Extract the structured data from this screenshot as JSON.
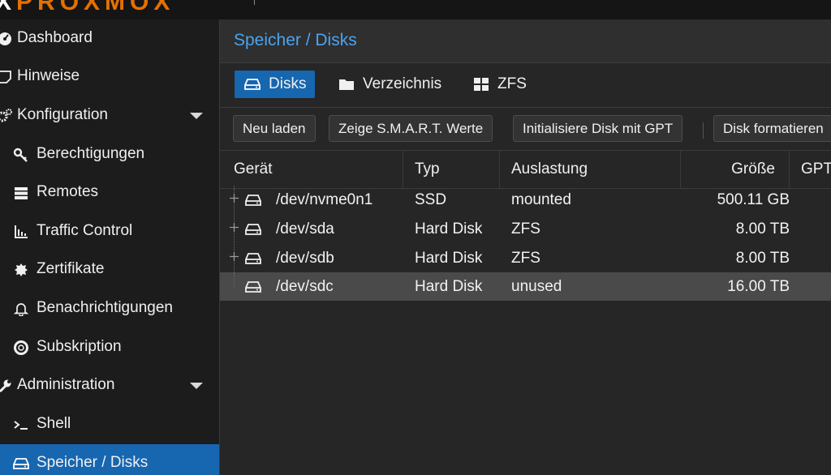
{
  "topbar": {
    "logo": "PROXMOX",
    "logo_x": "X"
  },
  "sidebar": {
    "items": [
      {
        "label": "Dashboard",
        "icon": "dashboard-icon"
      },
      {
        "label": "Hinweise",
        "icon": "note-icon"
      },
      {
        "label": "Konfiguration",
        "icon": "cogs-icon",
        "expanded": true
      },
      {
        "label": "Berechtigungen",
        "icon": "key-icon"
      },
      {
        "label": "Remotes",
        "icon": "server-icon"
      },
      {
        "label": "Traffic Control",
        "icon": "bar-chart-icon"
      },
      {
        "label": "Zertifikate",
        "icon": "certificate-icon"
      },
      {
        "label": "Benachrichtigungen",
        "icon": "bell-icon"
      },
      {
        "label": "Subskription",
        "icon": "support-icon"
      },
      {
        "label": "Administration",
        "icon": "wrench-icon",
        "expanded": true
      },
      {
        "label": "Shell",
        "icon": "terminal-icon"
      },
      {
        "label": "Speicher / Disks",
        "icon": "hdd-icon",
        "active": true
      }
    ]
  },
  "main": {
    "title": "Speicher / Disks",
    "tabs": [
      {
        "label": "Disks",
        "icon": "hdd-icon",
        "active": true
      },
      {
        "label": "Verzeichnis",
        "icon": "folder-icon"
      },
      {
        "label": "ZFS",
        "icon": "th-large-icon"
      }
    ],
    "toolbar": {
      "reload": "Neu laden",
      "smart": "Zeige S.M.A.R.T. Werte",
      "init_gpt": "Initialisiere Disk mit GPT",
      "format": "Disk formatieren"
    },
    "table": {
      "columns": [
        "Gerät",
        "Typ",
        "Auslastung",
        "Größe",
        "GPT"
      ],
      "rows": [
        {
          "device": "/dev/nvme0n1",
          "type": "SSD",
          "usage": "mounted",
          "size": "500.11 GB",
          "expandable": true
        },
        {
          "device": "/dev/sda",
          "type": "Hard Disk",
          "usage": "ZFS",
          "size": "8.00 TB",
          "expandable": true
        },
        {
          "device": "/dev/sdb",
          "type": "Hard Disk",
          "usage": "ZFS",
          "size": "8.00 TB",
          "expandable": true
        },
        {
          "device": "/dev/sdc",
          "type": "Hard Disk",
          "usage": "unused",
          "size": "16.00 TB",
          "expandable": false,
          "selected": true
        }
      ]
    }
  },
  "colors": {
    "accent": "#1766b0",
    "title": "#4aa3f0",
    "logo": "#e57000"
  }
}
